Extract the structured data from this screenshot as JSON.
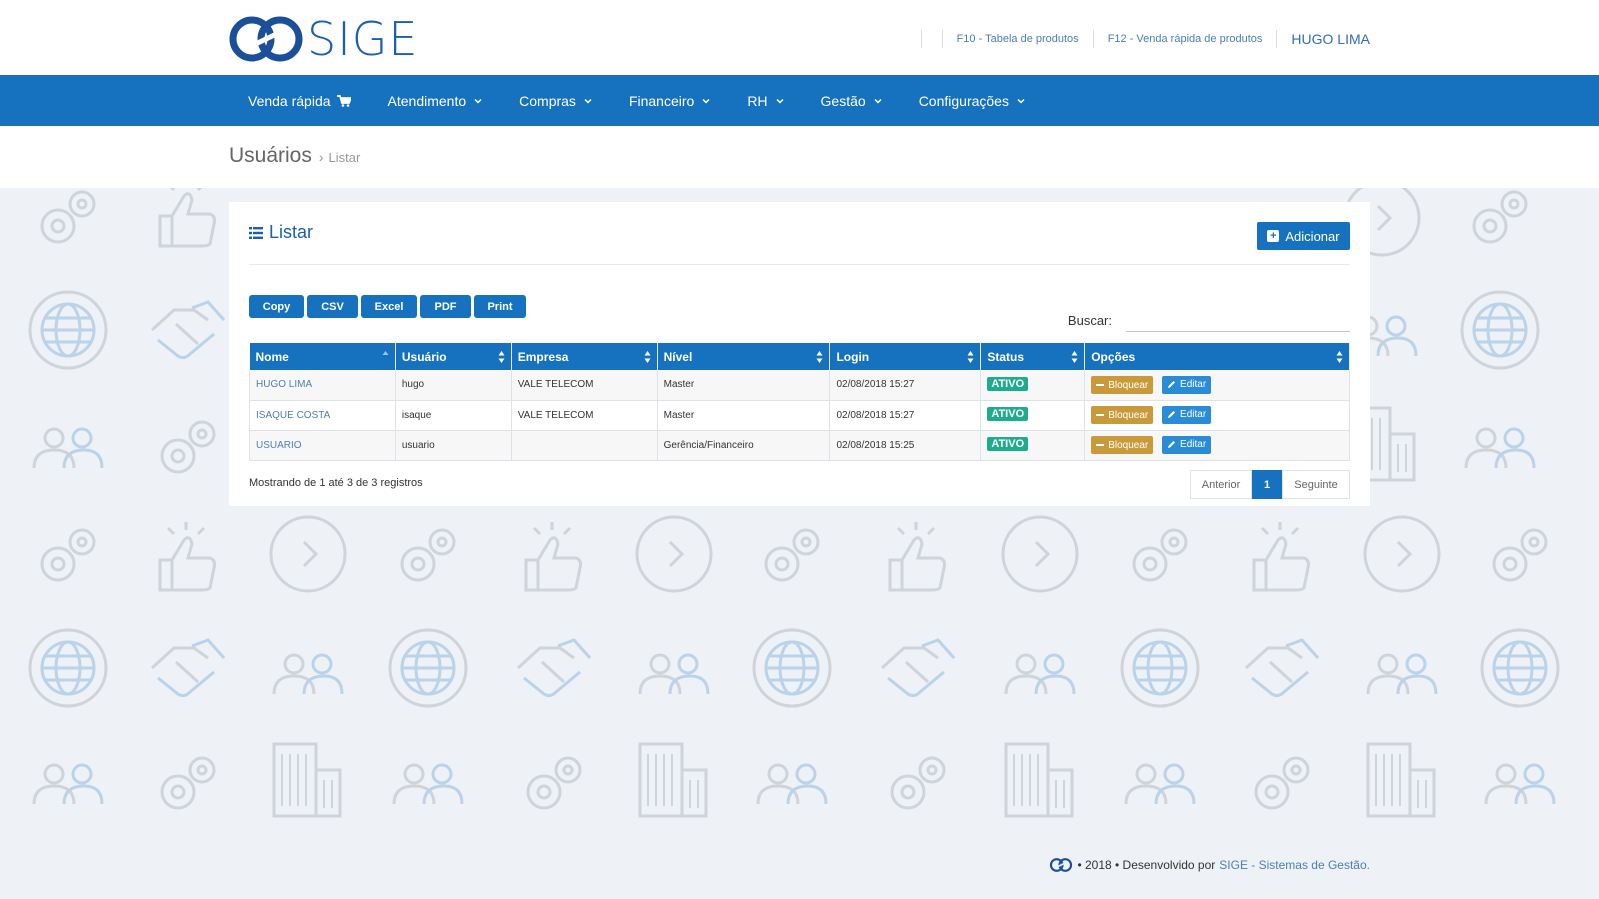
{
  "brand": {
    "name": "SIGE",
    "color": "#1b5fae"
  },
  "topnav": {
    "f10": "F10 - Tabela de produtos",
    "f12": "F12 - Venda rápida de produtos",
    "user": "HUGO LIMA"
  },
  "mainnav": {
    "items": [
      "Venda rápida",
      "Atendimento",
      "Compras",
      "Financeiro",
      "RH",
      "Gestão",
      "Configurações"
    ]
  },
  "breadcrumb": {
    "title": "Usuários",
    "sep": "›",
    "current": "Listar"
  },
  "panel": {
    "title": "Listar",
    "add_label": "Adicionar",
    "export": [
      "Copy",
      "CSV",
      "Excel",
      "PDF",
      "Print"
    ],
    "search_label": "Buscar:",
    "search_value": ""
  },
  "table": {
    "headers": [
      "Nome",
      "Usuário",
      "Empresa",
      "Nível",
      "Login",
      "Status",
      "Opções"
    ],
    "rows": [
      {
        "nome": "HUGO LIMA",
        "usuario": "hugo",
        "empresa": "VALE TELECOM",
        "nivel": "Master",
        "login": "02/08/2018 15:27",
        "status": "ATIVO"
      },
      {
        "nome": "ISAQUE COSTA",
        "usuario": "isaque",
        "empresa": "VALE TELECOM",
        "nivel": "Master",
        "login": "02/08/2018 15:27",
        "status": "ATIVO"
      },
      {
        "nome": "USUARIO",
        "usuario": "usuario",
        "empresa": "",
        "nivel": "Gerência/Financeiro",
        "login": "02/08/2018 15:25",
        "status": "ATIVO"
      }
    ],
    "block_label": "Bloquear",
    "edit_label": "Editar"
  },
  "info": "Mostrando de 1 até 3 de 3 registros",
  "pager": {
    "prev": "Anterior",
    "current": "1",
    "next": "Seguinte"
  },
  "footer": {
    "text": "• 2018 • Desenvolvido por",
    "link": "SIGE - Sistemas de Gestão."
  },
  "colors": {
    "primary": "#1672be",
    "status_active": "#1eac8d",
    "block": "#c99a3a",
    "edit": "#2a8bd6",
    "page_bg": "#eef1f5"
  }
}
